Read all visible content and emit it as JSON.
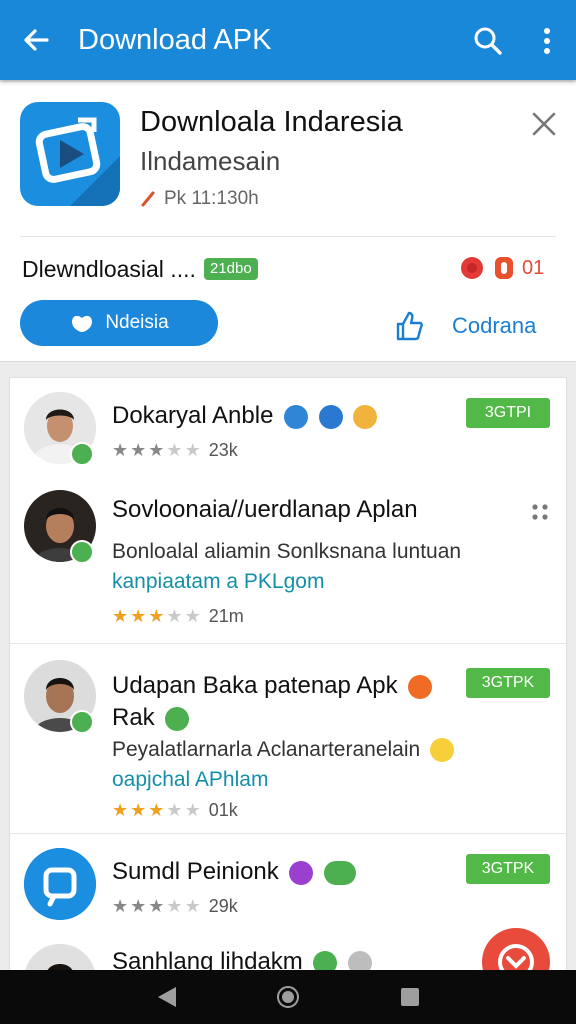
{
  "appbar": {
    "title": "Download APK"
  },
  "header": {
    "app_name": "Downloala Indaresia",
    "app_subtitle": "Ilndamesain",
    "app_meta": "Pk 11:130h",
    "row_label": "Dlewndloasial ....",
    "row_badge": "21dbo",
    "row_count": "01",
    "primary_button": "Ndeisia",
    "secondary_label": "Codrana"
  },
  "list": {
    "items": [
      {
        "title": "Dokaryal Anble",
        "count": "23k",
        "rating": 3,
        "action": "3GTPI"
      },
      {
        "title": "Sovloonaia//uerdlanap Aplan",
        "desc": "Bonloalal aliamin Sonlksnana luntuan",
        "link": "kanpiaatam a PKLgom",
        "count": "21m",
        "rating": 3
      },
      {
        "title": "Udapan Baka patenap Apk",
        "title2": "Rak",
        "desc": "Peyalatlarnarla Aclanarteranelain",
        "link": "oapjchal APhlam",
        "count": "01k",
        "rating": 3,
        "action": "3GTPK"
      },
      {
        "title": "Sumdl Peinionk",
        "count": "29k",
        "rating": 3,
        "action": "3GTPK"
      },
      {
        "title": "Sanhlang lihdakm"
      }
    ]
  },
  "colors": {
    "accent": "#1a88d8",
    "action_green": "#52b848",
    "link_teal": "#138fa8",
    "fab_red": "#e84a3c"
  },
  "icons": [
    "back-arrow-icon",
    "search-icon",
    "more-vert-icon",
    "close-icon",
    "thumbs-up-icon",
    "verified-icon",
    "drag-handle-icon",
    "play-badge-icon",
    "gamepad-icon",
    "emoji-icon",
    "nav-back-icon",
    "nav-home-icon",
    "nav-recent-icon"
  ]
}
